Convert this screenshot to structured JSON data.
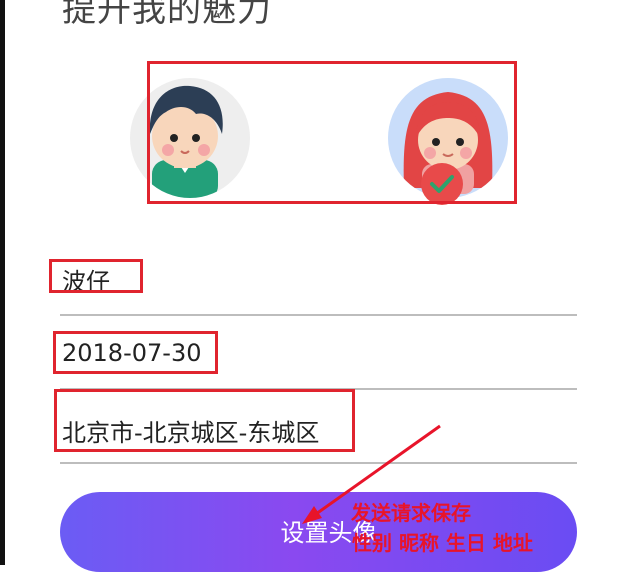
{
  "page": {
    "title": "提升我的魅力"
  },
  "avatars": {
    "male": "male-avatar-icon",
    "female": "female-avatar-icon",
    "selected": "female"
  },
  "form": {
    "nickname": "波仔",
    "birthday": "2018-07-30",
    "address": "北京市-北京城区-东城区"
  },
  "button": {
    "label": "设置头像"
  },
  "annotation": {
    "line1": "发送请求保存",
    "line2": "性别 昵称 生日 地址"
  },
  "colors": {
    "accent": "#e0242e",
    "button_start": "#6b5cf4",
    "button_mid": "#8a49f0"
  }
}
